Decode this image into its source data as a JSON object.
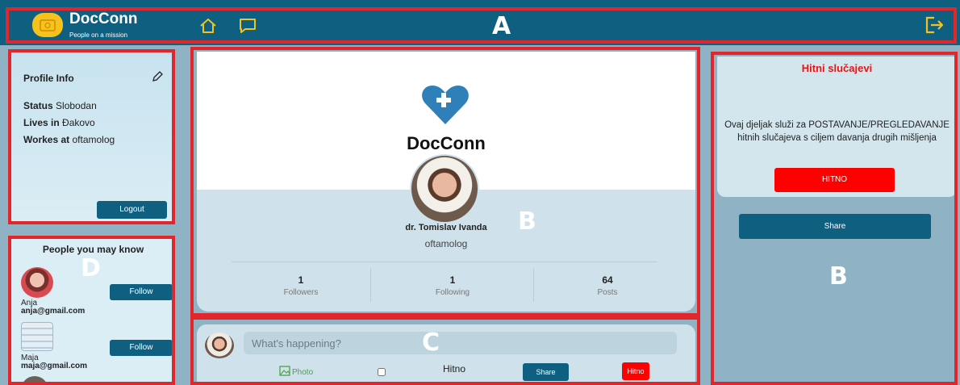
{
  "annotations": {
    "a": "A",
    "b": "B",
    "c": "C",
    "d": "D"
  },
  "header": {
    "title": "DocConn",
    "subtitle": "People on a mission",
    "icons": [
      "home-icon",
      "chat-icon",
      "logout-icon"
    ],
    "color": "#0f5f80"
  },
  "profile_info": {
    "title": "Profile Info",
    "status_label": "Status",
    "status_value": "Slobodan",
    "lives_label": "Lives in",
    "lives_value": "Đakovo",
    "works_label": "Workes at",
    "works_value": "oftamolog",
    "logout_label": "Logout"
  },
  "people": {
    "title": "People you may know",
    "follow_label": "Follow",
    "items": [
      {
        "name": "Anja",
        "email": "anja@gmail.com"
      },
      {
        "name": "Maja",
        "email": "maja@gmail.com"
      }
    ]
  },
  "profile": {
    "brand": "DocConn",
    "name": "dr. Tomislav Ivanda",
    "role": "oftamolog",
    "stats": [
      {
        "value": "1",
        "label": "Followers"
      },
      {
        "value": "1",
        "label": "Following"
      },
      {
        "value": "64",
        "label": "Posts"
      }
    ]
  },
  "composer": {
    "placeholder": "What's happening?",
    "photo_label": "Photo",
    "hitno_label": "Hitno",
    "share_label": "Share",
    "hitno_button": "Hitno"
  },
  "urgent": {
    "title": "Hitni slučajevi",
    "description": "Ovaj djeljak služi za POSTAVANJE/PREGLEDAVANJE hitnih slučajeva s ciljem davanja drugih mišljenja",
    "button_label": "HITNO",
    "share_label": "Share",
    "accent_color": "#ff0000"
  }
}
